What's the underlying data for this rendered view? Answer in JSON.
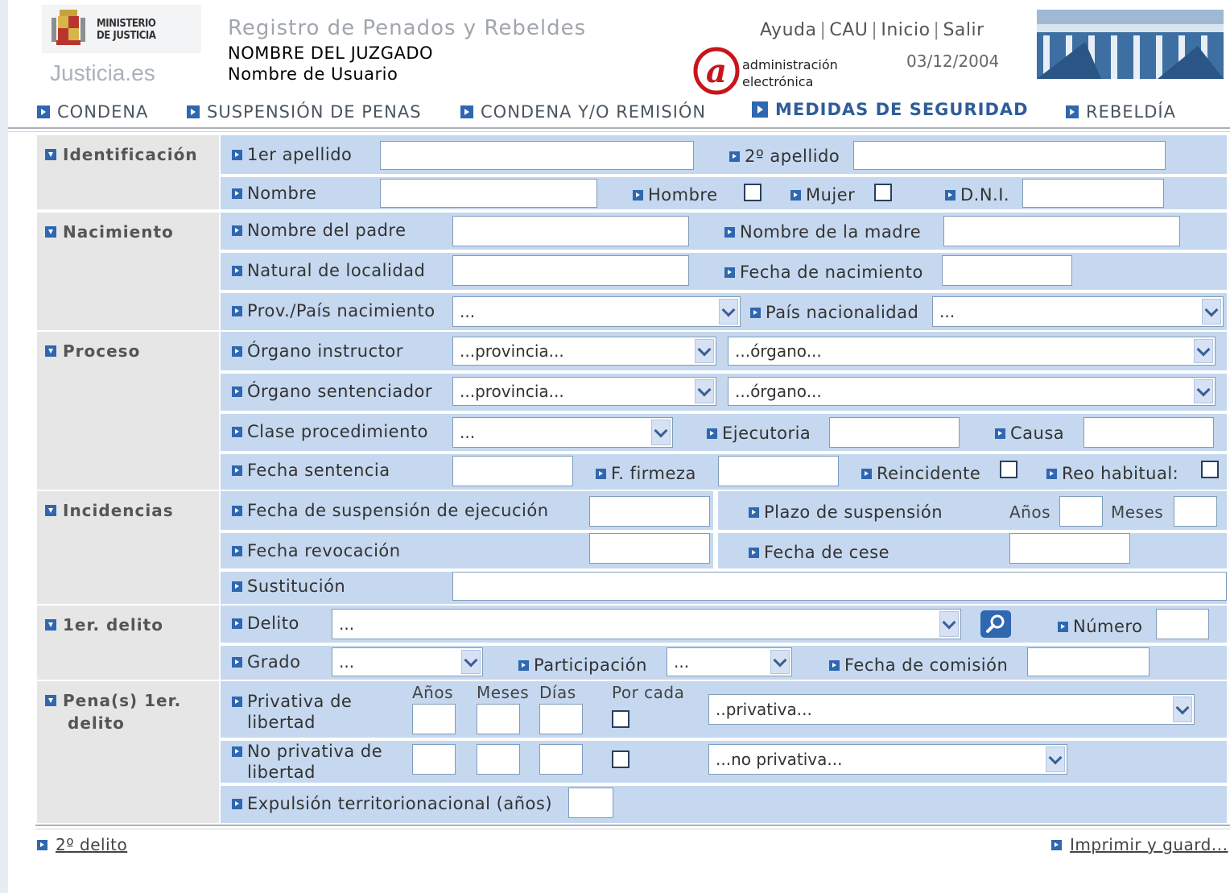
{
  "header": {
    "ministry_line1": "MINISTERIO",
    "ministry_line2": "DE JUSTICIA",
    "site": "Justicia.es",
    "app_title": "Registro de Penados y Rebeldes",
    "court": "NOMBRE DEL JUZGADO",
    "user": "Nombre de Usuario",
    "links": [
      "Ayuda",
      "CAU",
      "Inicio",
      "Salir"
    ],
    "date": "03/12/2004",
    "ae_line1": "administración",
    "ae_line2": "electrónica"
  },
  "nav": {
    "tabs": [
      {
        "label": "CONDENA"
      },
      {
        "label": "SUSPENSIÓN DE PENAS"
      },
      {
        "label": "CONDENA Y/O REMISIÓN"
      },
      {
        "label": "MEDIDAS DE SEGURIDAD"
      },
      {
        "label": "REBELDÍA"
      }
    ],
    "active_index": 3
  },
  "sections": {
    "identificacion": "Identificación",
    "nacimiento": "Nacimiento",
    "proceso": "Proceso",
    "incidencias": "Incidencias",
    "delito1": "1er. delito",
    "pena_line1": "Pena(s) 1er.",
    "pena_line2": "delito"
  },
  "fields": {
    "apellido1": "1er apellido",
    "apellido2": "2º apellido",
    "nombre": "Nombre",
    "hombre": "Hombre",
    "mujer": "Mujer",
    "dni": "D.N.I.",
    "padre": "Nombre del padre",
    "madre": "Nombre de la madre",
    "localidad": "Natural de localidad",
    "fecha_nac": "Fecha de nacimiento",
    "prov_pais": "Prov./País nacimiento",
    "pais_nac": "País nacionalidad",
    "organo_instructor": "Órgano instructor",
    "organo_sentenciador": "Órgano sentenciador",
    "clase_proc": "Clase procedimiento",
    "ejecutoria": "Ejecutoria",
    "causa": "Causa",
    "fecha_sentencia": "Fecha sentencia",
    "f_firmeza": "F. firmeza",
    "reincidente": "Reincidente",
    "reo_habitual": "Reo habitual:",
    "fecha_susp": "Fecha de suspensión de ejecución",
    "plazo_susp": "Plazo de suspensión",
    "anos": "Años",
    "meses": "Meses",
    "fecha_revoc": "Fecha revocación",
    "fecha_cese": "Fecha de cese",
    "sustitucion": "Sustitución",
    "delito": "Delito",
    "numero": "Número",
    "grado": "Grado",
    "participacion": "Participación",
    "fecha_comision": "Fecha de comisión",
    "privativa_l1": "Privativa de",
    "privativa_l2": "libertad",
    "noprivativa_l1": "No privativa de",
    "noprivativa_l2": "libertad",
    "col_anos": "Años",
    "col_meses": "Meses",
    "col_dias": "Días",
    "col_porcada": "Por cada",
    "expulsion": "Expulsión territorionacional (años)"
  },
  "selects": {
    "prov_pais": "...",
    "pais_nac": "...",
    "instr_prov": "...provincia...",
    "instr_org": "...órgano...",
    "sent_prov": "...provincia...",
    "sent_org": "...órgano...",
    "clase_proc": "...",
    "delito": "...",
    "grado": "...",
    "participacion": "...",
    "privativa": "..privativa...",
    "noprivativa": "...no privativa..."
  },
  "footer": {
    "left_link": "2º delito",
    "right_link": "Imprimir y guard..."
  },
  "colors": {
    "row_bg": "#c5d8ef",
    "section_bg": "#e6e6e6",
    "accent": "#2f67b0",
    "active_tab": "#2e5d99"
  }
}
